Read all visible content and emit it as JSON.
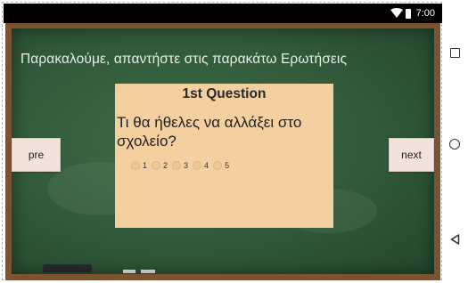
{
  "status_bar": {
    "time": "7:00",
    "wifi_icon": "wifi-icon",
    "battery_icon": "battery-icon"
  },
  "screen": {
    "instruction": "Παρακαλούμε, απαντήστε  στις παρακάτω Ερωτήσεις"
  },
  "question_card": {
    "title": "1st Question",
    "question": "Τι θα ήθελες να αλλάξει στο σχολείο?",
    "options": [
      "1",
      "2",
      "3",
      "4",
      "5"
    ]
  },
  "navigation": {
    "prev_label": "pre",
    "next_label": "next"
  },
  "system_nav": {
    "recents_icon": "square-icon",
    "home_icon": "circle-icon",
    "back_icon": "triangle-back-icon"
  },
  "colors": {
    "board_green": "#30583a",
    "wood_frame": "#7a5431",
    "card_background": "#f4cfa0",
    "button_background": "#f1e3db"
  }
}
